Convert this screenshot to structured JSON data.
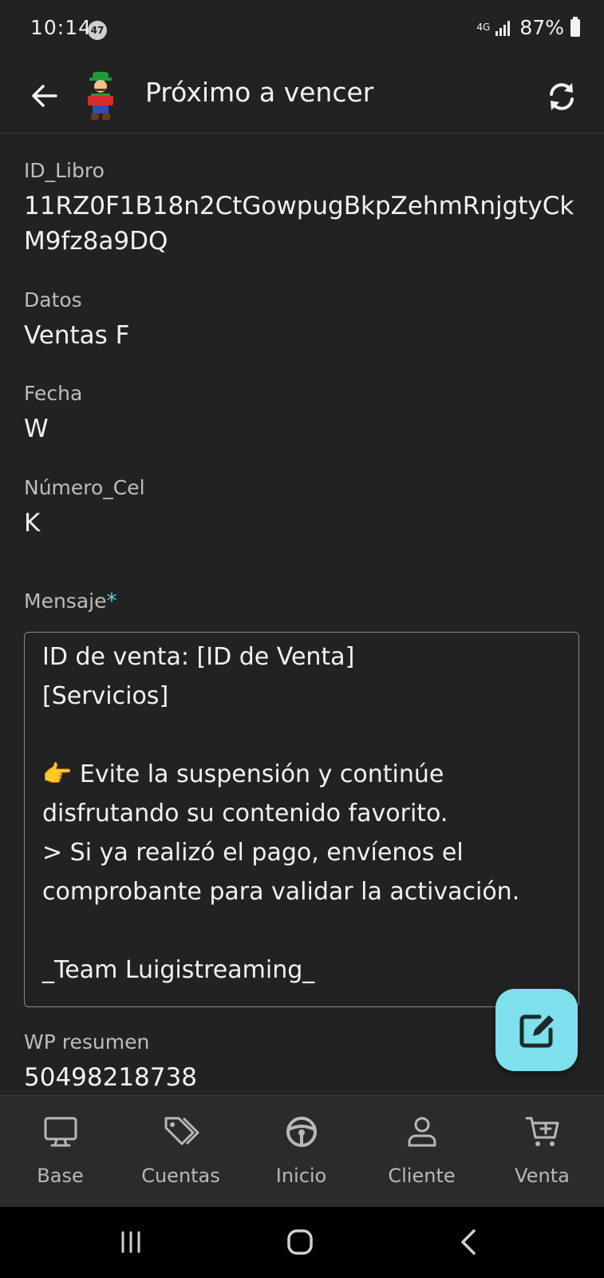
{
  "status": {
    "time": "10:14",
    "badge": "47",
    "network": "4G",
    "battery": "87%"
  },
  "appbar": {
    "title": "Próximo a vencer"
  },
  "fields": {
    "id_libro": {
      "label": "ID_Libro",
      "value": "11RZ0F1B18n2CtGowpugBkpZehmRnjgtyCkM9fz8a9DQ"
    },
    "datos": {
      "label": "Datos",
      "value": "Ventas F"
    },
    "fecha": {
      "label": "Fecha",
      "value": "W"
    },
    "numero_cel": {
      "label": "Número_Cel",
      "value": "K"
    },
    "mensaje": {
      "label": "Mensaje",
      "required_mark": "*",
      "lines": [
        "ID de venta: [ID de Venta]",
        "[Servicios]",
        "",
        "👉 Evite la suspensión y continúe",
        "disfrutando su contenido favorito.",
        "> Si ya realizó el pago, envíenos el",
        "comprobante para validar la activación.",
        "",
        "_Team Luigistreaming_"
      ]
    },
    "wp_resumen": {
      "label": "WP resumen",
      "value": "50498218738"
    }
  },
  "nav": {
    "base": "Base",
    "cuentas": "Cuentas",
    "inicio": "Inicio",
    "cliente": "Cliente",
    "venta": "Venta"
  },
  "colors": {
    "accent": "#7ee0ec",
    "background": "#222222",
    "navbar": "#2b2b2b"
  }
}
